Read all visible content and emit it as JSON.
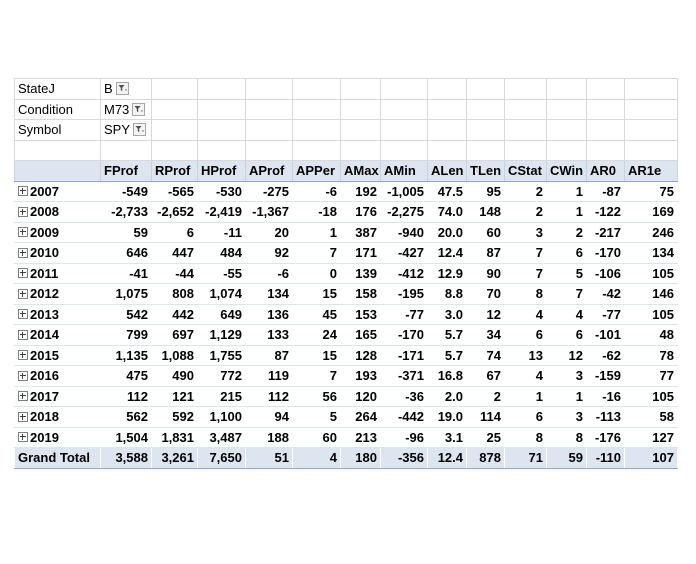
{
  "filters": [
    {
      "field": "StateJ",
      "value": "B"
    },
    {
      "field": "Condition",
      "value": "M73"
    },
    {
      "field": "Symbol",
      "value": "SPY"
    }
  ],
  "columns": [
    "FProf",
    "RProf",
    "HProf",
    "AProf",
    "APPer",
    "AMax",
    "AMin",
    "ALen",
    "TLen",
    "CStat",
    "CWin",
    "AR0",
    "AR1e"
  ],
  "rows": [
    {
      "label": "2007",
      "values": [
        "-549",
        "-565",
        "-530",
        "-275",
        "-6",
        "192",
        "-1,005",
        "47.5",
        "95",
        "2",
        "1",
        "-87",
        "75"
      ]
    },
    {
      "label": "2008",
      "values": [
        "-2,733",
        "-2,652",
        "-2,419",
        "-1,367",
        "-18",
        "176",
        "-2,275",
        "74.0",
        "148",
        "2",
        "1",
        "-122",
        "169"
      ]
    },
    {
      "label": "2009",
      "values": [
        "59",
        "6",
        "-11",
        "20",
        "1",
        "387",
        "-940",
        "20.0",
        "60",
        "3",
        "2",
        "-217",
        "246"
      ]
    },
    {
      "label": "2010",
      "values": [
        "646",
        "447",
        "484",
        "92",
        "7",
        "171",
        "-427",
        "12.4",
        "87",
        "7",
        "6",
        "-170",
        "134"
      ]
    },
    {
      "label": "2011",
      "values": [
        "-41",
        "-44",
        "-55",
        "-6",
        "0",
        "139",
        "-412",
        "12.9",
        "90",
        "7",
        "5",
        "-106",
        "105"
      ]
    },
    {
      "label": "2012",
      "values": [
        "1,075",
        "808",
        "1,074",
        "134",
        "15",
        "158",
        "-195",
        "8.8",
        "70",
        "8",
        "7",
        "-42",
        "146"
      ]
    },
    {
      "label": "2013",
      "values": [
        "542",
        "442",
        "649",
        "136",
        "45",
        "153",
        "-77",
        "3.0",
        "12",
        "4",
        "4",
        "-77",
        "105"
      ]
    },
    {
      "label": "2014",
      "values": [
        "799",
        "697",
        "1,129",
        "133",
        "24",
        "165",
        "-170",
        "5.7",
        "34",
        "6",
        "6",
        "-101",
        "48"
      ]
    },
    {
      "label": "2015",
      "values": [
        "1,135",
        "1,088",
        "1,755",
        "87",
        "15",
        "128",
        "-171",
        "5.7",
        "74",
        "13",
        "12",
        "-62",
        "78"
      ]
    },
    {
      "label": "2016",
      "values": [
        "475",
        "490",
        "772",
        "119",
        "7",
        "193",
        "-371",
        "16.8",
        "67",
        "4",
        "3",
        "-159",
        "77"
      ]
    },
    {
      "label": "2017",
      "values": [
        "112",
        "121",
        "215",
        "112",
        "56",
        "120",
        "-36",
        "2.0",
        "2",
        "1",
        "1",
        "-16",
        "105"
      ]
    },
    {
      "label": "2018",
      "values": [
        "562",
        "592",
        "1,100",
        "94",
        "5",
        "264",
        "-442",
        "19.0",
        "114",
        "6",
        "3",
        "-113",
        "58"
      ]
    },
    {
      "label": "2019",
      "values": [
        "1,504",
        "1,831",
        "3,487",
        "188",
        "60",
        "213",
        "-96",
        "3.1",
        "25",
        "8",
        "8",
        "-176",
        "127"
      ]
    }
  ],
  "grand_total": {
    "label": "Grand Total",
    "values": [
      "3,588",
      "3,261",
      "7,650",
      "51",
      "4",
      "180",
      "-356",
      "12.4",
      "878",
      "71",
      "59",
      "-110",
      "107"
    ]
  },
  "icons": {
    "row_expander": "expand-plus-icon",
    "filter": "filter-icon"
  },
  "colors": {
    "header_fill": "#dde6f0",
    "grid": "#d9d9d9"
  }
}
